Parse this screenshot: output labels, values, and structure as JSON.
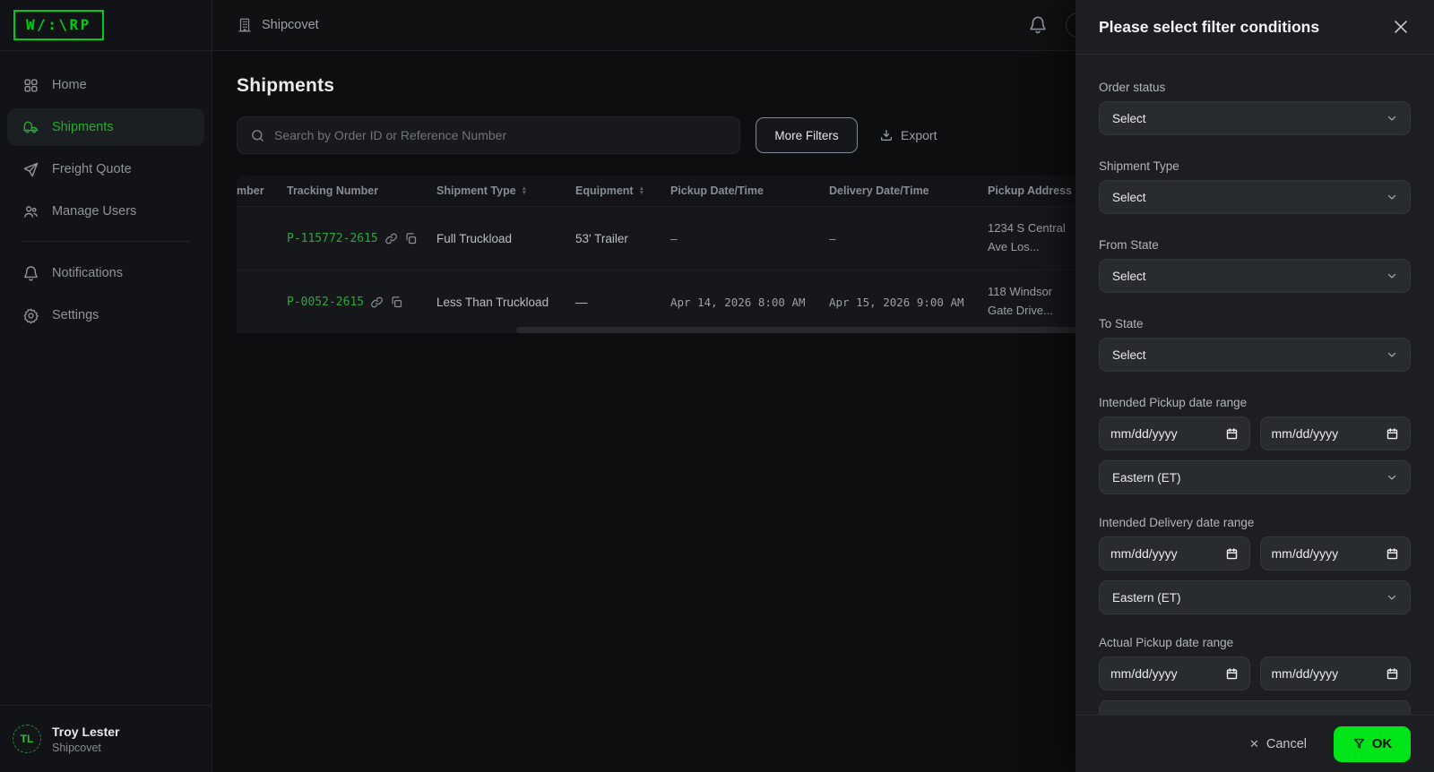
{
  "brand": {
    "logo_text": "W/:\\RP"
  },
  "topbar": {
    "company": "Shipcovet"
  },
  "sidebar": {
    "items": [
      {
        "label": "Home"
      },
      {
        "label": "Shipments"
      },
      {
        "label": "Freight Quote"
      },
      {
        "label": "Manage Users"
      },
      {
        "label": "Notifications"
      },
      {
        "label": "Settings"
      }
    ],
    "user": {
      "initials": "TL",
      "name": "Troy Lester",
      "company": "Shipcovet"
    }
  },
  "main": {
    "title": "Shipments",
    "search_placeholder": "Search by Order ID or Reference Number",
    "more_filters_label": "More Filters",
    "export_label": "Export"
  },
  "table": {
    "columns": [
      "mber",
      "Tracking Number",
      "Shipment Type",
      "Equipment",
      "Pickup Date/Time",
      "Delivery Date/Time",
      "Pickup Address"
    ],
    "rows": [
      {
        "tracking_number": "P-115772-2615",
        "shipment_type": "Full Truckload",
        "equipment": "53' Trailer",
        "pickup_datetime": "–",
        "delivery_datetime": "–",
        "pickup_address_line1": "1234 S Central",
        "pickup_address_line2": "Ave Los..."
      },
      {
        "tracking_number": "P-0052-2615",
        "shipment_type": "Less Than Truckload",
        "equipment": "—",
        "pickup_datetime": "Apr 14, 2026 8:00 AM",
        "delivery_datetime": "Apr 15, 2026 9:00 AM",
        "pickup_address_line1": "118 Windsor",
        "pickup_address_line2": "Gate Drive..."
      }
    ]
  },
  "panel": {
    "title": "Please select filter conditions",
    "fields": {
      "order_status": {
        "label": "Order status",
        "value": "Select"
      },
      "shipment_type": {
        "label": "Shipment Type",
        "value": "Select"
      },
      "from_state": {
        "label": "From State",
        "value": "Select"
      },
      "to_state": {
        "label": "To State",
        "value": "Select"
      },
      "intended_pickup": {
        "label": "Intended Pickup date range",
        "start_placeholder": "mm/dd/yyyy",
        "end_placeholder": "mm/dd/yyyy",
        "timezone": "Eastern (ET)"
      },
      "intended_delivery": {
        "label": "Intended Delivery date range",
        "start_placeholder": "mm/dd/yyyy",
        "end_placeholder": "mm/dd/yyyy",
        "timezone": "Eastern (ET)"
      },
      "actual_pickup": {
        "label": "Actual Pickup date range",
        "start_placeholder": "mm/dd/yyyy",
        "end_placeholder": "mm/dd/yyyy"
      }
    },
    "cancel_label": "Cancel",
    "ok_label": "OK"
  },
  "colors": {
    "accent_green": "#00E517",
    "link_green": "#2FA53C",
    "logo_green": "#00CC16"
  }
}
